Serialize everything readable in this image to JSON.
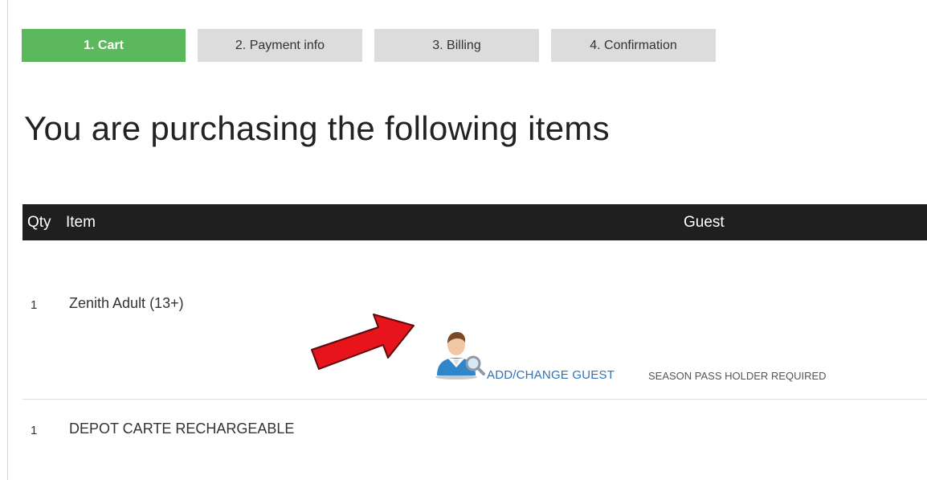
{
  "steps": [
    {
      "label": "1. Cart",
      "active": true
    },
    {
      "label": "2. Payment info",
      "active": false
    },
    {
      "label": "3. Billing",
      "active": false
    },
    {
      "label": "4. Confirmation",
      "active": false
    }
  ],
  "page_title": "You are purchasing the following items",
  "table": {
    "headers": {
      "qty": "Qty",
      "item": "Item",
      "guest": "Guest"
    },
    "rows": [
      {
        "qty": "1",
        "item": "Zenith Adult (13+)",
        "guest_link": "ADD/CHANGE GUEST",
        "guest_note": "SEASON PASS HOLDER REQUIRED",
        "guest_icon": "person-search-icon"
      },
      {
        "qty": "1",
        "item": "DEPOT CARTE RECHARGEABLE"
      }
    ]
  },
  "colors": {
    "active_step": "#5cb85c",
    "inactive_step": "#dcdcdc",
    "table_header": "#1f1f1f",
    "link": "#2f72b8",
    "annotation_arrow": "#e8141c"
  },
  "annotation": {
    "icon": "red-arrow-icon"
  }
}
